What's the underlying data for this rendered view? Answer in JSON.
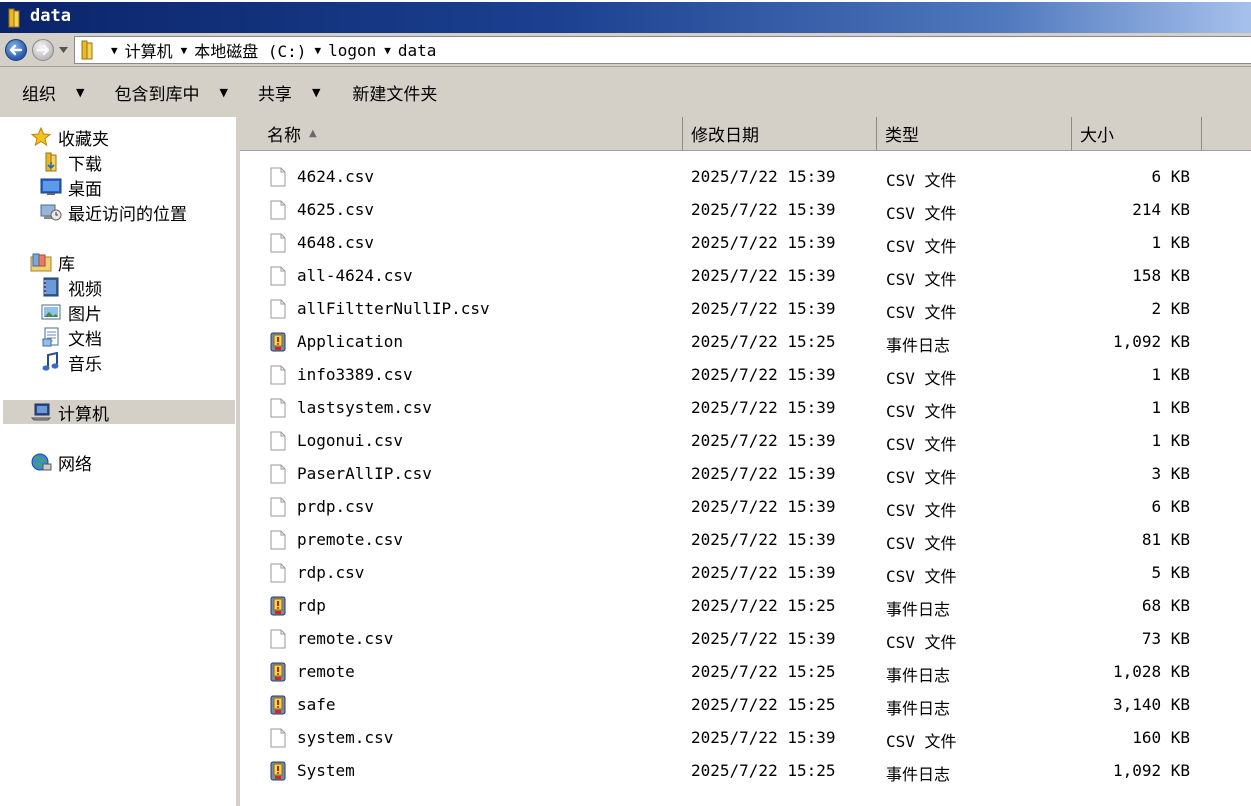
{
  "window": {
    "title": "data"
  },
  "address": {
    "crumbs": [
      "计算机",
      "本地磁盘 (C:)",
      "logon",
      "data"
    ]
  },
  "toolbar": {
    "organize": "组织",
    "include_library": "包含到库中",
    "share": "共享",
    "new_folder": "新建文件夹"
  },
  "sidebar": {
    "favorites": "收藏夹",
    "downloads": "下载",
    "desktop": "桌面",
    "recent": "最近访问的位置",
    "libraries": "库",
    "videos": "视频",
    "pictures": "图片",
    "documents": "文档",
    "music": "音乐",
    "computer": "计算机",
    "network": "网络"
  },
  "columns": {
    "name": "名称",
    "modified": "修改日期",
    "type": "类型",
    "size": "大小"
  },
  "files": [
    {
      "name": "4624.csv",
      "date": "2025/7/22 15:39",
      "type": "CSV 文件",
      "size": "6 KB",
      "icon": "csv-file-icon"
    },
    {
      "name": "4625.csv",
      "date": "2025/7/22 15:39",
      "type": "CSV 文件",
      "size": "214 KB",
      "icon": "csv-file-icon"
    },
    {
      "name": "4648.csv",
      "date": "2025/7/22 15:39",
      "type": "CSV 文件",
      "size": "1 KB",
      "icon": "csv-file-icon"
    },
    {
      "name": "all-4624.csv",
      "date": "2025/7/22 15:39",
      "type": "CSV 文件",
      "size": "158 KB",
      "icon": "csv-file-icon"
    },
    {
      "name": "allFiltterNullIP.csv",
      "date": "2025/7/22 15:39",
      "type": "CSV 文件",
      "size": "2 KB",
      "icon": "csv-file-icon"
    },
    {
      "name": "Application",
      "date": "2025/7/22 15:25",
      "type": "事件日志",
      "size": "1,092 KB",
      "icon": "event-log-icon"
    },
    {
      "name": "info3389.csv",
      "date": "2025/7/22 15:39",
      "type": "CSV 文件",
      "size": "1 KB",
      "icon": "csv-file-icon"
    },
    {
      "name": "lastsystem.csv",
      "date": "2025/7/22 15:39",
      "type": "CSV 文件",
      "size": "1 KB",
      "icon": "csv-file-icon"
    },
    {
      "name": "Logonui.csv",
      "date": "2025/7/22 15:39",
      "type": "CSV 文件",
      "size": "1 KB",
      "icon": "csv-file-icon"
    },
    {
      "name": "PaserAllIP.csv",
      "date": "2025/7/22 15:39",
      "type": "CSV 文件",
      "size": "3 KB",
      "icon": "csv-file-icon"
    },
    {
      "name": "prdp.csv",
      "date": "2025/7/22 15:39",
      "type": "CSV 文件",
      "size": "6 KB",
      "icon": "csv-file-icon"
    },
    {
      "name": "premote.csv",
      "date": "2025/7/22 15:39",
      "type": "CSV 文件",
      "size": "81 KB",
      "icon": "csv-file-icon"
    },
    {
      "name": "rdp.csv",
      "date": "2025/7/22 15:39",
      "type": "CSV 文件",
      "size": "5 KB",
      "icon": "csv-file-icon"
    },
    {
      "name": "rdp",
      "date": "2025/7/22 15:25",
      "type": "事件日志",
      "size": "68 KB",
      "icon": "event-log-icon"
    },
    {
      "name": "remote.csv",
      "date": "2025/7/22 15:39",
      "type": "CSV 文件",
      "size": "73 KB",
      "icon": "csv-file-icon"
    },
    {
      "name": "remote",
      "date": "2025/7/22 15:25",
      "type": "事件日志",
      "size": "1,028 KB",
      "icon": "event-log-icon"
    },
    {
      "name": "safe",
      "date": "2025/7/22 15:25",
      "type": "事件日志",
      "size": "3,140 KB",
      "icon": "event-log-icon"
    },
    {
      "name": "system.csv",
      "date": "2025/7/22 15:39",
      "type": "CSV 文件",
      "size": "160 KB",
      "icon": "csv-file-icon"
    },
    {
      "name": "System",
      "date": "2025/7/22 15:25",
      "type": "事件日志",
      "size": "1,092 KB",
      "icon": "event-log-icon"
    }
  ],
  "colors": {
    "title_start": "#0a246a",
    "title_end": "#a6c1ec",
    "chrome": "#d4d0c8"
  }
}
